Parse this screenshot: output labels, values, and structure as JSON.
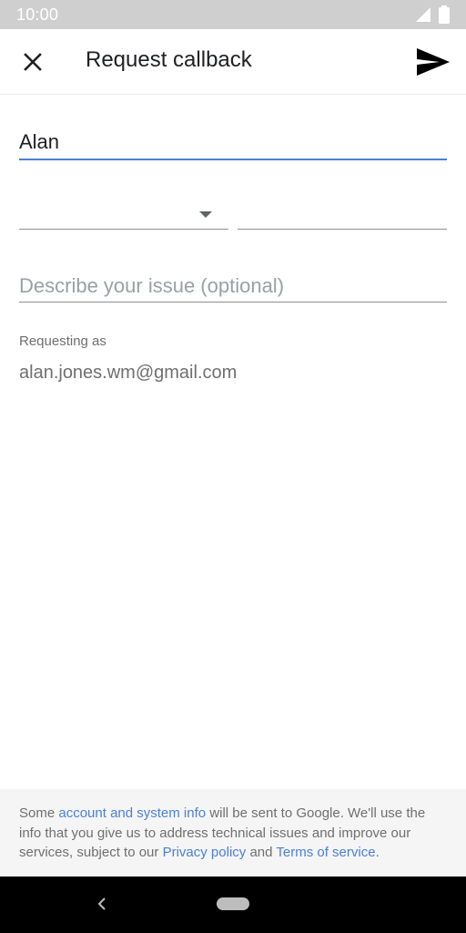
{
  "status_bar": {
    "time": "10:00",
    "icons": [
      "signal-icon",
      "battery-icon"
    ]
  },
  "app_bar": {
    "title": "Request callback",
    "close_icon": "close-icon",
    "send_icon": "send-icon"
  },
  "form": {
    "name_value": "Alan",
    "country_code_value": "",
    "phone_value": "",
    "issue_placeholder": "Describe your issue (optional)",
    "issue_value": ""
  },
  "requesting": {
    "label": "Requesting as",
    "email": "alan.jones.wm@gmail.com"
  },
  "footer": {
    "part1": "Some ",
    "link1": "account and system info",
    "part2": " will be sent to Google. We'll use the info that you give us to address technical issues and improve our services, subject to our ",
    "link2": "Privacy policy",
    "part3": " and ",
    "link3": "Terms of service",
    "part4": "."
  },
  "colors": {
    "accent": "#4a7fd8",
    "status_bar_bg": "#cfcfcf",
    "footer_bg": "#f5f5f5",
    "nav_bar_bg": "#000000"
  }
}
